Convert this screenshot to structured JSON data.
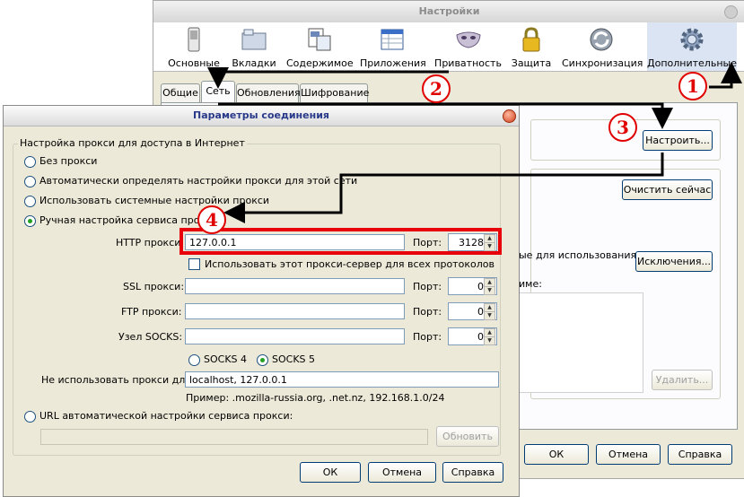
{
  "settings_window": {
    "title": "Настройки",
    "toolbar": [
      {
        "label": "Основные",
        "icon": "switch-icon"
      },
      {
        "label": "Вкладки",
        "icon": "folder-tabs-icon"
      },
      {
        "label": "Содержимое",
        "icon": "content-icon"
      },
      {
        "label": "Приложения",
        "icon": "applications-icon"
      },
      {
        "label": "Приватность",
        "icon": "mask-icon"
      },
      {
        "label": "Защита",
        "icon": "padlock-icon"
      },
      {
        "label": "Синхронизация",
        "icon": "sync-icon"
      },
      {
        "label": "Дополнительные",
        "icon": "gear-icon",
        "selected": true
      }
    ],
    "tabs": [
      "Общие",
      "Сеть",
      "Обновления",
      "Шифрование"
    ],
    "active_tab": "Сеть",
    "configure_button": "Настроить...",
    "clear_now_button": "Очистить сейчас",
    "partial_text_1": "ые для использования",
    "exceptions_button": "Исключения...",
    "partial_text_2": "име:",
    "remove_button": "Удалить...",
    "ok_button": "ОК",
    "cancel_button": "Отмена",
    "help_button": "Справка"
  },
  "dialog": {
    "title": "Параметры соединения",
    "group_label": "Настройка прокси для доступа в Интернет",
    "options": {
      "no_proxy": "Без прокси",
      "auto_detect": "Автоматически определять настройки прокси для этой сети",
      "system": "Использовать системные настройки прокси",
      "manual": "Ручная настройка сервиса прокси:",
      "auto_url": "URL автоматической настройки сервиса прокси:"
    },
    "selected_option": "manual",
    "http_label": "HTTP прокси:",
    "http_value": "127.0.0.1",
    "port_label": "Порт:",
    "http_port": "3128",
    "use_for_all": "Использовать этот прокси-сервер для всех протоколов",
    "ssl_label": "SSL прокси:",
    "ssl_port": "0",
    "ftp_label": "FTP прокси:",
    "ftp_port": "0",
    "socks_label": "Узел SOCKS:",
    "socks_port": "0",
    "socks4": "SOCKS 4",
    "socks5": "SOCKS 5",
    "socks_version_selected": "SOCKS 5",
    "no_proxy_label": "Не использовать прокси для:",
    "no_proxy_value": "localhost, 127.0.0.1",
    "example": "Пример: .mozilla-russia.org, .net.nz, 192.168.1.0/24",
    "reload_button": "Обновить",
    "ok_button": "ОК",
    "cancel_button": "Отмена",
    "help_button": "Справка"
  },
  "annotations": [
    "1",
    "2",
    "3",
    "4"
  ],
  "colors": {
    "annotation_red": "#e00000",
    "title_blue": "#2a3a8a",
    "selected_toolbar": "#dbe4f3"
  }
}
